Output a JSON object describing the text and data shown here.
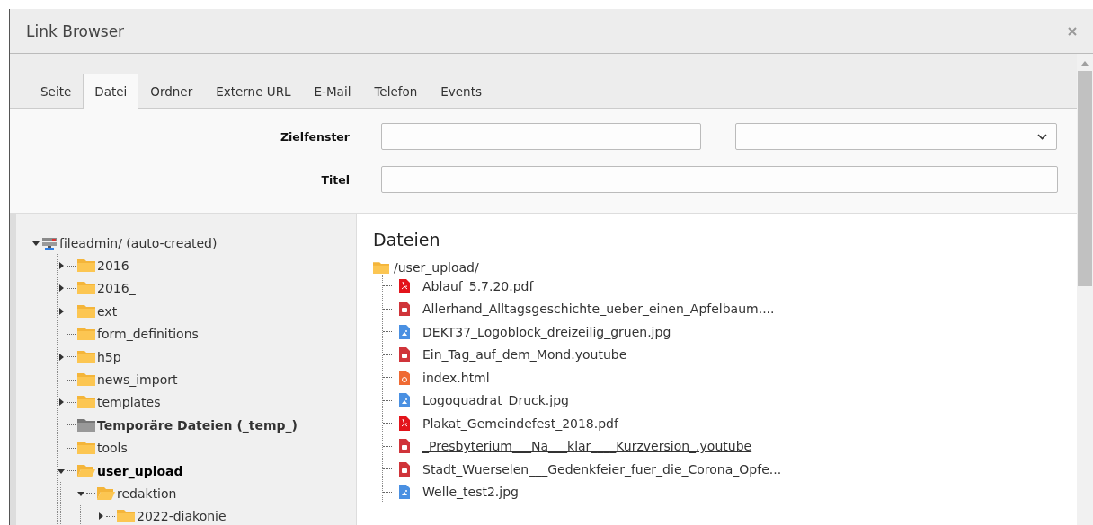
{
  "window": {
    "title": "Link Browser"
  },
  "tabs": [
    {
      "label": "Seite",
      "selected": false
    },
    {
      "label": "Datei",
      "selected": true
    },
    {
      "label": "Ordner",
      "selected": false
    },
    {
      "label": "Externe URL",
      "selected": false
    },
    {
      "label": "E-Mail",
      "selected": false
    },
    {
      "label": "Telefon",
      "selected": false
    },
    {
      "label": "Events",
      "selected": false
    }
  ],
  "form": {
    "target_label": "Zielfenster",
    "title_label": "Titel"
  },
  "tree": [
    {
      "label": "fileadmin/ (auto-created)",
      "kind": "storage",
      "expandable": true,
      "expanded": true,
      "selected": false,
      "children": [
        {
          "label": "2016",
          "kind": "folder",
          "expandable": true,
          "expanded": false,
          "selected": false
        },
        {
          "label": "2016_",
          "kind": "folder",
          "expandable": true,
          "expanded": false,
          "selected": false
        },
        {
          "label": "ext",
          "kind": "folder",
          "expandable": true,
          "expanded": false,
          "selected": false
        },
        {
          "label": "form_definitions",
          "kind": "folder",
          "expandable": false,
          "selected": false
        },
        {
          "label": "h5p",
          "kind": "folder",
          "expandable": true,
          "expanded": false,
          "selected": false
        },
        {
          "label": "news_import",
          "kind": "folder",
          "expandable": false,
          "selected": false
        },
        {
          "label": "templates",
          "kind": "folder",
          "expandable": true,
          "expanded": false,
          "selected": false
        },
        {
          "label": "Temporäre Dateien (_temp_)",
          "kind": "temp",
          "expandable": false,
          "selected": false
        },
        {
          "label": "tools",
          "kind": "folder",
          "expandable": false,
          "selected": false
        },
        {
          "label": "user_upload",
          "kind": "folder",
          "expandable": true,
          "expanded": true,
          "selected": true,
          "children": [
            {
              "label": "redaktion",
              "kind": "folder",
              "expandable": true,
              "expanded": true,
              "selected": false,
              "children": [
                {
                  "label": "2022-diakonie",
                  "kind": "folder",
                  "expandable": true,
                  "expanded": false,
                  "selected": false
                }
              ]
            }
          ]
        }
      ]
    }
  ],
  "files": {
    "heading": "Dateien",
    "path": "/user_upload/",
    "items": [
      {
        "name": "Ablauf_5.7.20.pdf",
        "kind": "pdf",
        "hovered": false
      },
      {
        "name": "Allerhand_Alltagsgeschichte_ueber_einen_Apfelbaum....",
        "kind": "video",
        "hovered": false
      },
      {
        "name": "DEKT37_Logoblock_dreizeilig_gruen.jpg",
        "kind": "image",
        "hovered": false
      },
      {
        "name": "Ein_Tag_auf_dem_Mond.youtube",
        "kind": "video",
        "hovered": false
      },
      {
        "name": "index.html",
        "kind": "html",
        "hovered": false
      },
      {
        "name": "Logoquadrat_Druck.jpg",
        "kind": "image",
        "hovered": false
      },
      {
        "name": "Plakat_Gemeindefest_2018.pdf",
        "kind": "pdf",
        "hovered": false
      },
      {
        "name": "_Presbyterium___Na___klar____Kurzversion_.youtube",
        "kind": "video",
        "hovered": true
      },
      {
        "name": "Stadt_Wuerselen___Gedenkfeier_fuer_die_Corona_Opfe...",
        "kind": "video",
        "hovered": false
      },
      {
        "name": "Welle_test2.jpg",
        "kind": "image",
        "hovered": false
      }
    ]
  }
}
